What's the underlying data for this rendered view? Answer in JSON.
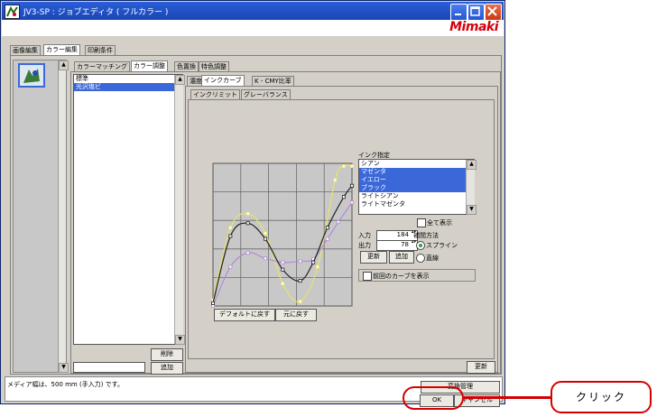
{
  "window": {
    "title": "JV3-SP : ジョブエディタ ( フルカラー )",
    "brand": "Mimaki"
  },
  "top_tabs": [
    "画像編集",
    "カラー編集",
    "印刷条件"
  ],
  "sub_tabs": [
    "カラーマッチング",
    "カラー調整",
    "色置換",
    "特色調整"
  ],
  "adjust_list": {
    "items": [
      "標準",
      "光沢塩ビ"
    ],
    "selected": 1
  },
  "list_buttons": {
    "delete": "削除",
    "add": "追加"
  },
  "inner_tabs": [
    "濃度",
    "インクカーブ",
    "K - CMY比率"
  ],
  "sub_inner_tabs": [
    "インクリミット",
    "グレーバランス"
  ],
  "chart_data": {
    "type": "line",
    "title": "",
    "xlabel": "",
    "ylabel": "",
    "xlim": [
      0,
      255
    ],
    "ylim": [
      0,
      255
    ],
    "grid": true,
    "series": [
      {
        "name": "",
        "color": "#e8e36a",
        "x": [
          0,
          32,
          64,
          96,
          128,
          160,
          192,
          224,
          240,
          255
        ],
        "y": [
          10,
          140,
          165,
          130,
          40,
          8,
          70,
          225,
          250,
          250
        ]
      },
      {
        "name": "",
        "color": "#b48ad8",
        "x": [
          0,
          32,
          64,
          96,
          128,
          160,
          184,
          210,
          230,
          255
        ],
        "y": [
          0,
          70,
          95,
          85,
          78,
          80,
          84,
          120,
          150,
          185
        ]
      },
      {
        "name": "",
        "color": "#222222",
        "x": [
          0,
          32,
          64,
          96,
          128,
          160,
          184,
          210,
          240,
          255
        ],
        "y": [
          5,
          125,
          148,
          120,
          65,
          45,
          78,
          140,
          195,
          215
        ]
      }
    ]
  },
  "chart_buttons": {
    "default": "デフォルトに戻す",
    "restore": "元に戻す"
  },
  "ink_spec": {
    "label": "インク指定",
    "items": [
      "シアン",
      "マゼンタ",
      "イエロー",
      "ブラック",
      "ライトシアン",
      "ライトマゼンタ"
    ],
    "selected": [
      1,
      2,
      3
    ]
  },
  "show_all": "全て表示",
  "input_label": "入力",
  "input_value": "184",
  "output_label": "出力",
  "output_value": "78",
  "update_label": "更新",
  "add_label": "追加",
  "interp": {
    "label": "補間方法",
    "options": [
      "スプライン",
      "直線"
    ],
    "selected": 0
  },
  "prev_curve": "前回のカーブを表示",
  "panel_update": "更新",
  "status": "メディア幅は、500 mm (手入力) です。",
  "bottom": {
    "manage": "変換管理",
    "ok": "OK",
    "cancel": "キャンセル"
  },
  "callout": "クリック"
}
